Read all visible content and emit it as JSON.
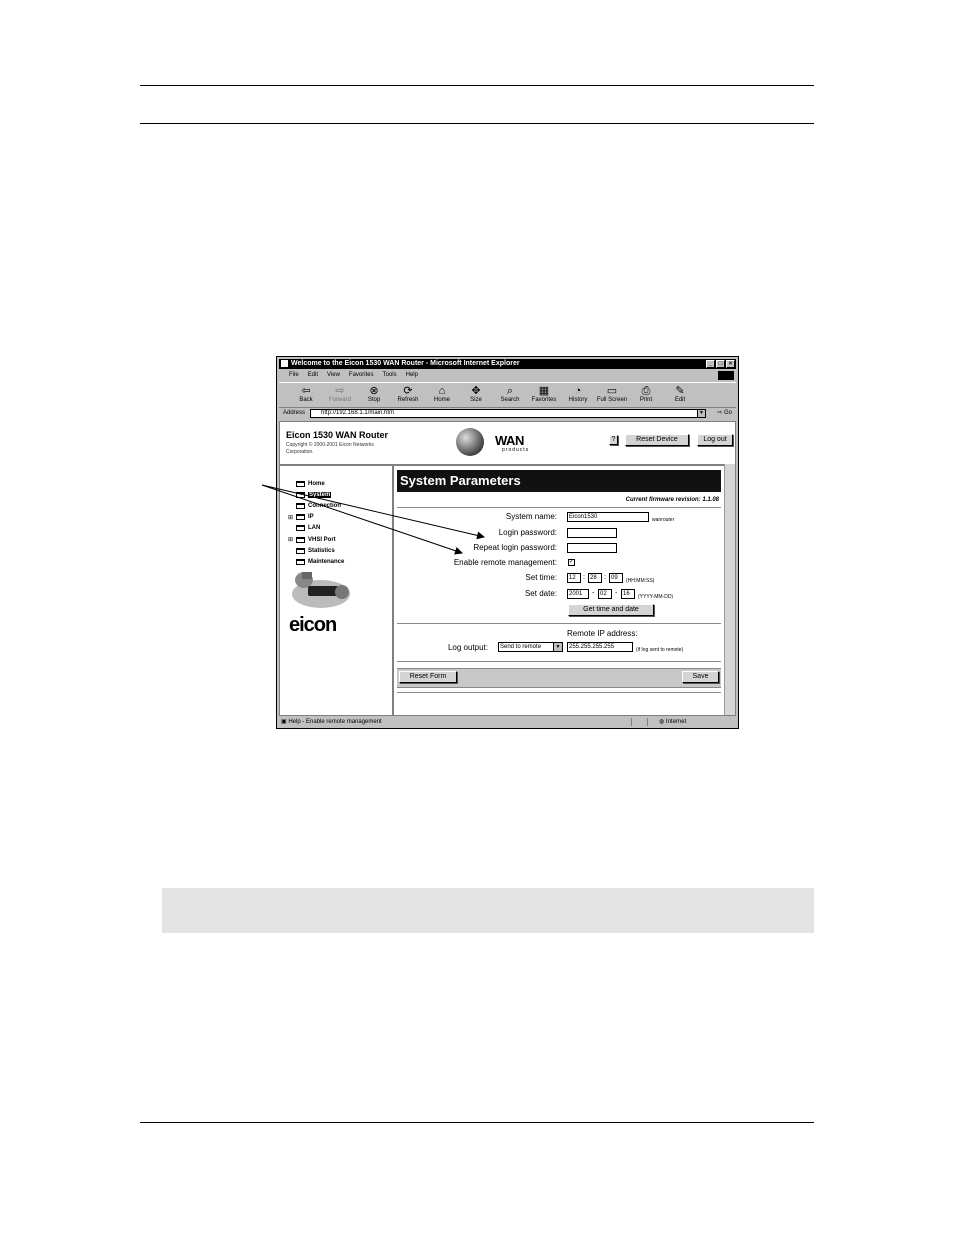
{
  "window": {
    "title": "Welcome to the Eicon 1530 WAN Router - Microsoft Internet Explorer",
    "menu": [
      "File",
      "Edit",
      "View",
      "Favorites",
      "Tools",
      "Help"
    ],
    "toolbar": [
      {
        "label": "Back",
        "icon": "back-arrow-icon",
        "glyph": "⇦",
        "disabled": false
      },
      {
        "label": "Forward",
        "icon": "forward-arrow-icon",
        "glyph": "⇨",
        "disabled": true
      },
      {
        "label": "Stop",
        "icon": "stop-icon",
        "glyph": "⊗",
        "disabled": false
      },
      {
        "label": "Refresh",
        "icon": "refresh-icon",
        "glyph": "⟳",
        "disabled": false
      },
      {
        "label": "Home",
        "icon": "home-icon",
        "glyph": "⌂",
        "disabled": false
      },
      {
        "label": "Size",
        "icon": "size-icon",
        "glyph": "✥",
        "disabled": false
      },
      {
        "label": "Search",
        "icon": "search-icon",
        "glyph": "⌕",
        "disabled": false
      },
      {
        "label": "Favorites",
        "icon": "favorites-icon",
        "glyph": "▦",
        "disabled": false
      },
      {
        "label": "History",
        "icon": "history-icon",
        "glyph": "◔",
        "disabled": false
      },
      {
        "label": "Full Screen",
        "icon": "full-screen-icon",
        "glyph": "▭",
        "disabled": false
      },
      {
        "label": "Print",
        "icon": "print-icon",
        "glyph": "⎙",
        "disabled": false
      },
      {
        "label": "Edit",
        "icon": "edit-icon",
        "glyph": "✎",
        "disabled": false
      }
    ],
    "address_label": "Address",
    "address": "http://192.168.1.1/main.htm",
    "go_label": "Go",
    "status_text": "Help - Enable remote management",
    "status_zone": "Internet"
  },
  "header": {
    "product": "Eicon 1530 WAN Router",
    "copyright": "Copyright © 2000-2001 Eicon Networks Corporation.",
    "wan_logo": "WAN",
    "wan_sub": "products",
    "help_label": "?",
    "reset_device": "Reset Device",
    "log_out": "Log out"
  },
  "sidebar": {
    "items": [
      {
        "label": "Home",
        "expandable": false,
        "selected": false
      },
      {
        "label": "System",
        "expandable": false,
        "selected": true
      },
      {
        "label": "Connection",
        "expandable": false,
        "selected": false
      },
      {
        "label": "IP",
        "expandable": true,
        "selected": false
      },
      {
        "label": "LAN",
        "expandable": false,
        "selected": false
      },
      {
        "label": "VHSI Port",
        "expandable": true,
        "selected": false
      },
      {
        "label": "Statistics",
        "expandable": false,
        "selected": false
      },
      {
        "label": "Maintenance",
        "expandable": false,
        "selected": false
      }
    ],
    "expand_glyph": "⊞",
    "logo": "eicon"
  },
  "form": {
    "title": "System Parameters",
    "firmware": "Current firmware revision: 1.1.08",
    "system_name_label": "System name:",
    "system_name_value": "Eicon1530",
    "system_name_hint": "wanrouter",
    "login_password_label": "Login password:",
    "repeat_password_label": "Repeat login password:",
    "remote_mgmt_label": "Enable remote management:",
    "remote_mgmt_checked": true,
    "check_glyph": "✓",
    "set_time_label": "Set time:",
    "time_hh": "12",
    "time_mm": "28",
    "time_ss": "09",
    "time_hint": "(HH:MM:SS)",
    "set_date_label": "Set date:",
    "date_yyyy": "2001",
    "date_mm": "02",
    "date_dd": "16",
    "date_hint": "(YYYY-MM-DD)",
    "get_time_button": "Get time and date",
    "remote_ip_label": "Remote IP address:",
    "log_output_label": "Log output:",
    "log_output_value": "Send to remote",
    "remote_ip_value": "255.255.255.255",
    "remote_ip_hint": "(if log sent to remote)",
    "reset_form": "Reset Form",
    "save": "Save"
  }
}
